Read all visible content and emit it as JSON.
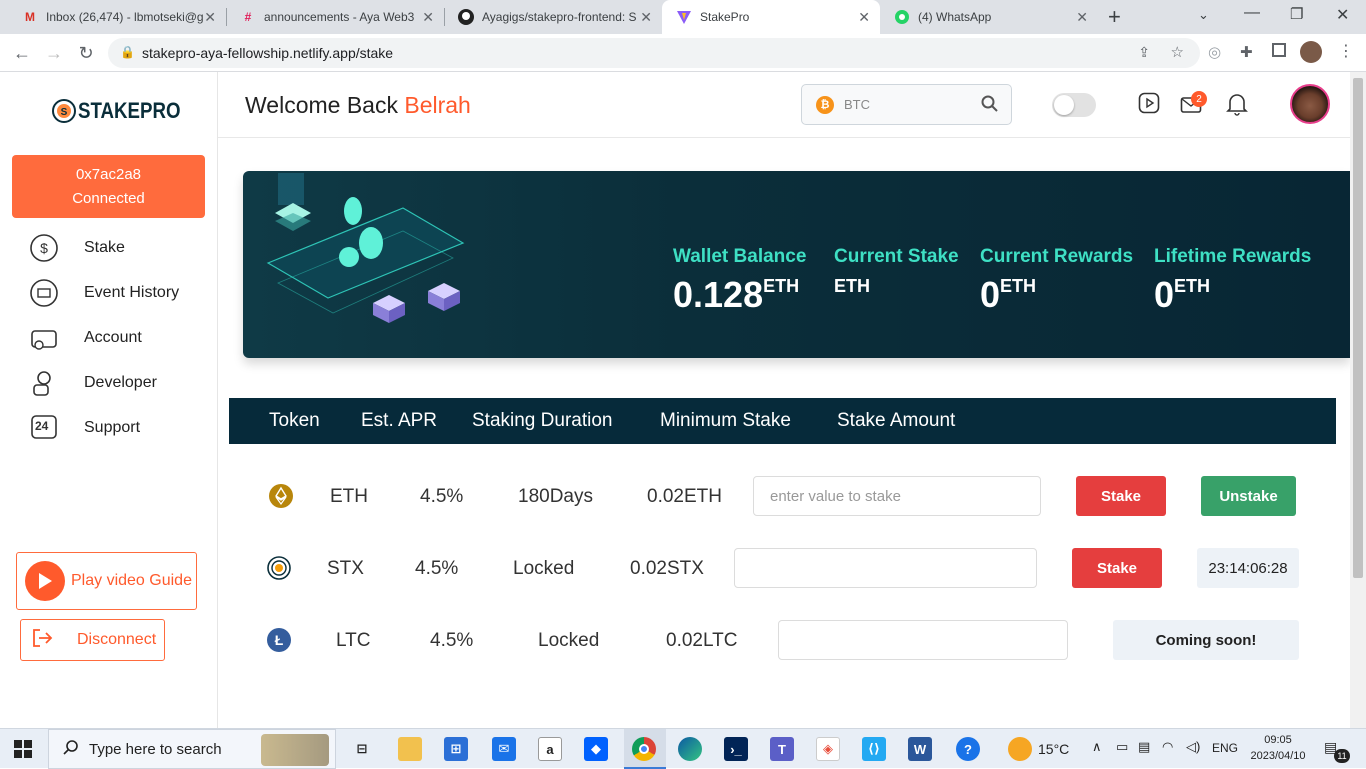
{
  "browser": {
    "tabs": [
      {
        "title": "Inbox (26,474) - lbmotseki@g",
        "icon": "gmail-icon",
        "color": "#d93025"
      },
      {
        "title": "announcements - Aya Web3",
        "icon": "slack-icon",
        "color": "#611f69"
      },
      {
        "title": "Ayagigs/stakepro-frontend: S",
        "icon": "github-icon",
        "color": "#222222"
      },
      {
        "title": "StakePro",
        "icon": "vite-icon",
        "color": "#8b5cf6"
      },
      {
        "title": "(4) WhatsApp",
        "icon": "whatsapp-icon",
        "color": "#25d366"
      }
    ],
    "new_tab": "+",
    "url": "stakepro-aya-fellowship.netlify.app/stake"
  },
  "brand": {
    "name": "STAKEPRO"
  },
  "wallet": {
    "address": "0x7ac2a8",
    "status": "Connected"
  },
  "nav": [
    {
      "label": "Stake",
      "icon": "dollar-exchange-icon"
    },
    {
      "label": "Event History",
      "icon": "history-icon"
    },
    {
      "label": "Account",
      "icon": "wallet-icon"
    },
    {
      "label": "Developer",
      "icon": "developer-icon"
    },
    {
      "label": "Support",
      "icon": "support-24-icon"
    }
  ],
  "support_icon_text": "24",
  "sidebar_buttons": {
    "video": "Play video Guide",
    "disconnect": "Disconnect"
  },
  "header": {
    "welcome": "Welcome Back",
    "username": "Belrah",
    "search_value": "BTC",
    "notification_count": "2"
  },
  "stats": [
    {
      "label": "Wallet Balance",
      "value": "0.128",
      "unit": "ETH"
    },
    {
      "label": "Current Stake",
      "value": "",
      "unit": "ETH"
    },
    {
      "label": "Current Rewards",
      "value": "0",
      "unit": "ETH"
    },
    {
      "label": "Lifetime Rewards",
      "value": "0",
      "unit": "ETH"
    }
  ],
  "table": {
    "headers": [
      "Token",
      "Est. APR",
      "Staking Duration",
      "Minimum Stake",
      "Stake Amount"
    ],
    "rows": [
      {
        "token": "ETH",
        "apr": "4.5%",
        "duration": "180Days",
        "min": "0.02ETH",
        "placeholder": "enter value to stake",
        "stake": "Stake",
        "extra": "Unstake"
      },
      {
        "token": "STX",
        "apr": "4.5%",
        "duration": "Locked",
        "min": "0.02STX",
        "placeholder": "",
        "stake": "Stake",
        "extra": "23:14:06:28"
      },
      {
        "token": "LTC",
        "apr": "4.5%",
        "duration": "Locked",
        "min": "0.02LTC",
        "placeholder": "",
        "extra": "Coming soon!"
      }
    ]
  },
  "taskbar": {
    "search_placeholder": "Type here to search",
    "weather": "15°C",
    "language": "ENG",
    "time": "09:05",
    "date": "2023/04/10",
    "notif_badge": "11"
  },
  "colors": {
    "accent_orange": "#ff6b3d",
    "stake_red": "#e53e3e",
    "unstake_green": "#38a169",
    "teal_text": "#3ee0c4",
    "header_dark": "#062a3a"
  }
}
